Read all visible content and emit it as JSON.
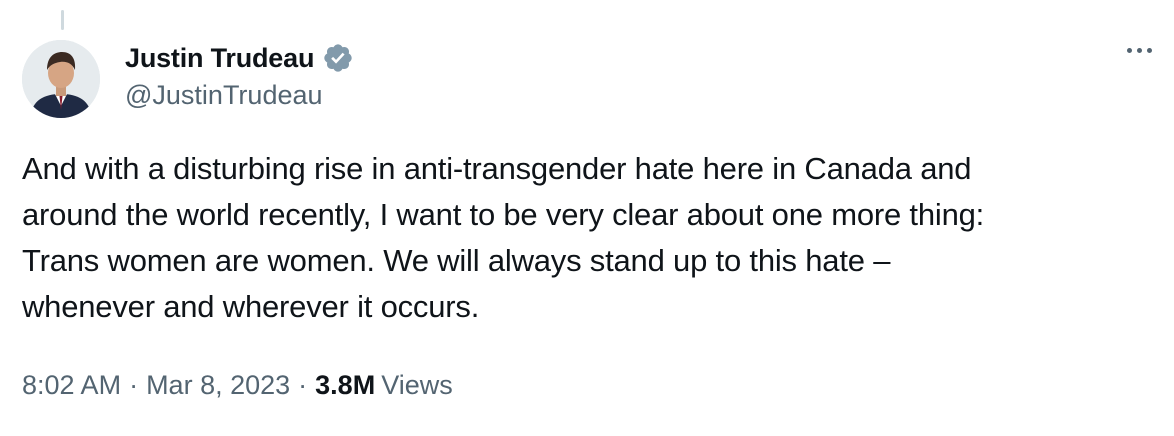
{
  "author": {
    "display_name": "Justin Trudeau",
    "handle": "@JustinTrudeau",
    "verified": true
  },
  "tweet": {
    "text": "And with a disturbing rise in anti-transgender hate here in Canada and\naround the world recently, I want to be very clear about one more thing:\nTrans women are women. We will always stand up to this hate –\nwhenever and wherever it occurs."
  },
  "meta": {
    "time": "8:02 AM",
    "separator": "·",
    "date": "Mar 8, 2023",
    "views_count": "3.8M",
    "views_label": "Views"
  },
  "icons": {
    "verified": "verified-badge-icon",
    "more": "more-options-icon"
  },
  "colors": {
    "text_primary": "#0f1419",
    "text_secondary": "#536471",
    "verified_badge": "#829aab"
  }
}
